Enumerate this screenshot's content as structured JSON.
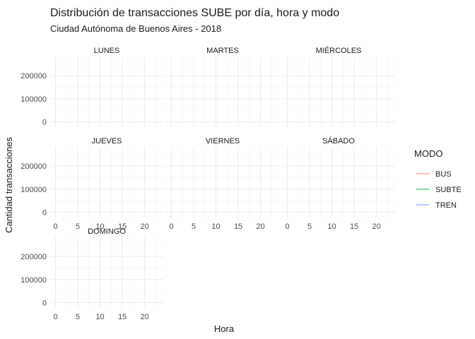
{
  "chart_data": {
    "type": "line",
    "title": "Distribución de transacciones SUBE por día, hora y modo",
    "subtitle": "Ciudad Autónoma de Buenos Aires - 2018",
    "xlabel": "Hora",
    "ylabel": "Cantidad transacciones",
    "xlim": [
      0,
      23
    ],
    "ylim": [
      0,
      260000
    ],
    "x_ticks": [
      0,
      5,
      10,
      15,
      20
    ],
    "y_ticks": [
      0,
      100000,
      200000
    ],
    "grid": true,
    "facet_by": "day",
    "facets": [
      {
        "label": "LUNES"
      },
      {
        "label": "MARTES"
      },
      {
        "label": "MIÉRCOLES"
      },
      {
        "label": "JUEVES"
      },
      {
        "label": "VIERNES"
      },
      {
        "label": "SÁBADO"
      },
      {
        "label": "DOMINGO"
      }
    ],
    "series": [
      {
        "name": "BUS",
        "color": "#F8766D"
      },
      {
        "name": "SUBTE",
        "color": "#00BA38"
      },
      {
        "name": "TREN",
        "color": "#619CFF"
      }
    ],
    "legend_title": "MODO",
    "legend_position": "right"
  }
}
